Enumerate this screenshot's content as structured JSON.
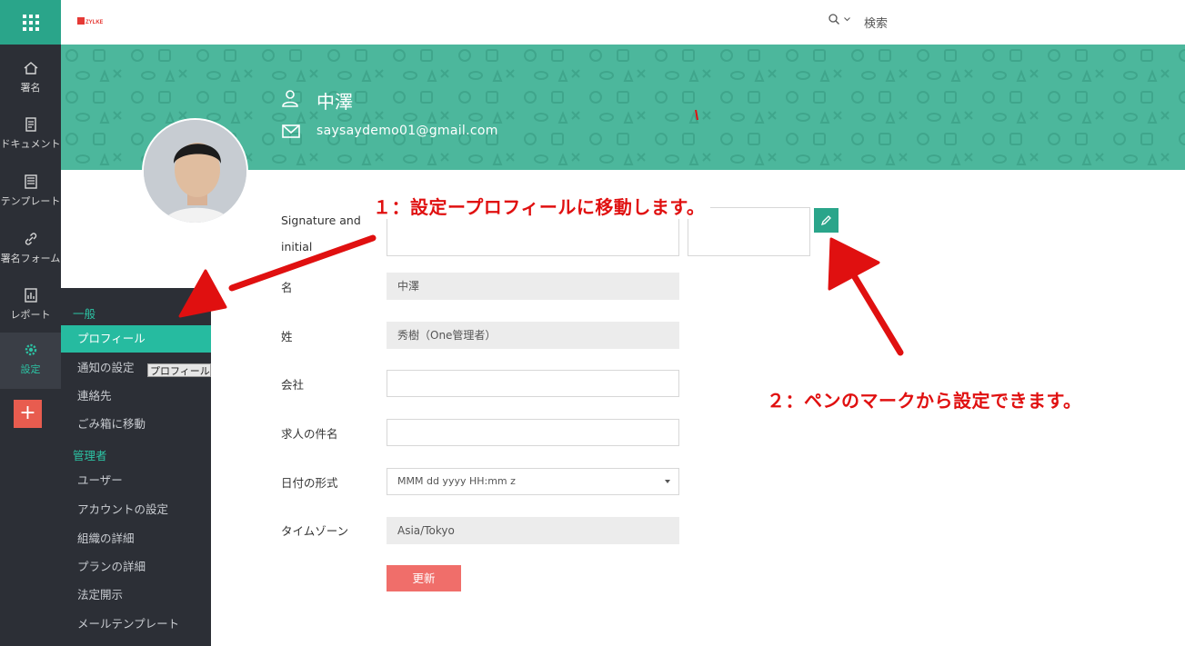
{
  "app": {
    "logo_text": "ZYLKER",
    "search_label": "検索"
  },
  "rail": {
    "items": [
      {
        "label": "署名",
        "icon": "home-icon"
      },
      {
        "label": "ドキュメント",
        "icon": "document-icon"
      },
      {
        "label": "テンプレート",
        "icon": "template-icon"
      },
      {
        "label": "署名フォーム",
        "icon": "link-icon"
      },
      {
        "label": "レポート",
        "icon": "report-icon"
      },
      {
        "label": "設定",
        "icon": "gear-icon"
      }
    ],
    "add_label": "+"
  },
  "profile": {
    "name": "中澤",
    "email": "saysaydemo01@gmail.com"
  },
  "menu": {
    "general_header": "一般",
    "general_items": [
      "プロフィール",
      "通知の設定",
      "連絡先",
      "ごみ箱に移動"
    ],
    "admin_header": "管理者",
    "admin_items": [
      "ユーザー",
      "アカウントの設定",
      "組織の詳細",
      "プランの詳細",
      "法定開示",
      "メールテンプレート"
    ],
    "tooltip": "プロフィール"
  },
  "form": {
    "signature_label_1": "Signature and",
    "signature_label_2": "initial",
    "first_name_label": "名",
    "first_name_value": "中澤",
    "last_name_label": "姓",
    "last_name_value": "秀樹（One管理者）",
    "company_label": "会社",
    "company_value": "",
    "job_title_label": "求人の件名",
    "job_title_value": "",
    "date_format_label": "日付の形式",
    "date_format_value": "MMM dd yyyy HH:mm z",
    "timezone_label": "タイムゾーン",
    "timezone_value": "Asia/Tokyo",
    "update_label": "更新"
  },
  "annotations": {
    "step1": "１：設定ープロフィールに移動します。",
    "step2": "２：ペンのマークから設定できます。"
  },
  "colors": {
    "brand_green": "#2aa58a",
    "banner": "#4cb79c",
    "sidebar": "#2c2f36",
    "update_button": "#f06e6a",
    "annotation_red": "#e01010"
  }
}
